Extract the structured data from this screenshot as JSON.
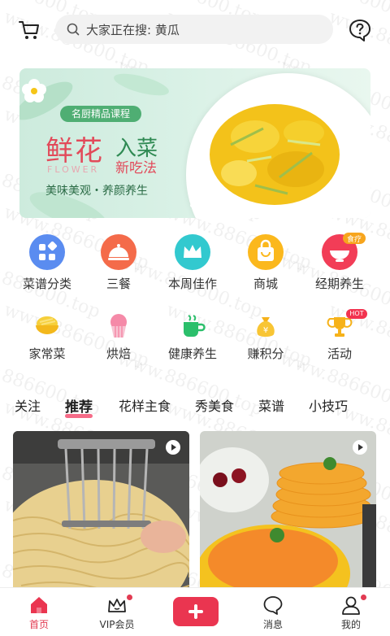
{
  "watermark": "www.886600.top",
  "search": {
    "placeholder": "大家正在搜: 黄瓜"
  },
  "banner": {
    "tag": "名厨精品课程",
    "title_main": "鲜花",
    "title_side1": "入菜",
    "title_side2": "新吃法",
    "flower_en": "FLOWER",
    "slogan": "美味美观・养颜养生"
  },
  "categories_row1": [
    {
      "label": "菜谱分类",
      "icon": "grid-icon",
      "color": "#5a8cf0"
    },
    {
      "label": "三餐",
      "icon": "cloche-icon",
      "color": "#f46b4a"
    },
    {
      "label": "本周佳作",
      "icon": "crown-icon",
      "color": "#32c9cf"
    },
    {
      "label": "商城",
      "icon": "shopping-bag-icon",
      "color": "#fbb81d"
    },
    {
      "label": "经期养生",
      "icon": "bowl-icon",
      "color": "#f23d57",
      "badge": "食疗"
    }
  ],
  "categories_row2": [
    {
      "label": "家常菜",
      "icon": "rice-bowl-icon"
    },
    {
      "label": "烘焙",
      "icon": "cupcake-icon"
    },
    {
      "label": "健康养生",
      "icon": "tea-cup-icon"
    },
    {
      "label": "赚积分",
      "icon": "money-bag-icon"
    },
    {
      "label": "活动",
      "icon": "trophy-icon",
      "badge": "HOT"
    }
  ],
  "tabs": [
    "关注",
    "推荐",
    "花样主食",
    "秀美食",
    "菜谱",
    "小技巧"
  ],
  "active_tab": "推荐",
  "bottom_nav": [
    {
      "label": "首页",
      "icon": "home-icon",
      "active": true
    },
    {
      "label": "VIP会员",
      "icon": "crown-outline-icon"
    },
    {
      "label": "",
      "icon": "plus-icon"
    },
    {
      "label": "消息",
      "icon": "chat-icon"
    },
    {
      "label": "我的",
      "icon": "user-icon"
    }
  ],
  "colors": {
    "accent": "#ea3550",
    "banner_green": "#4fae73"
  }
}
